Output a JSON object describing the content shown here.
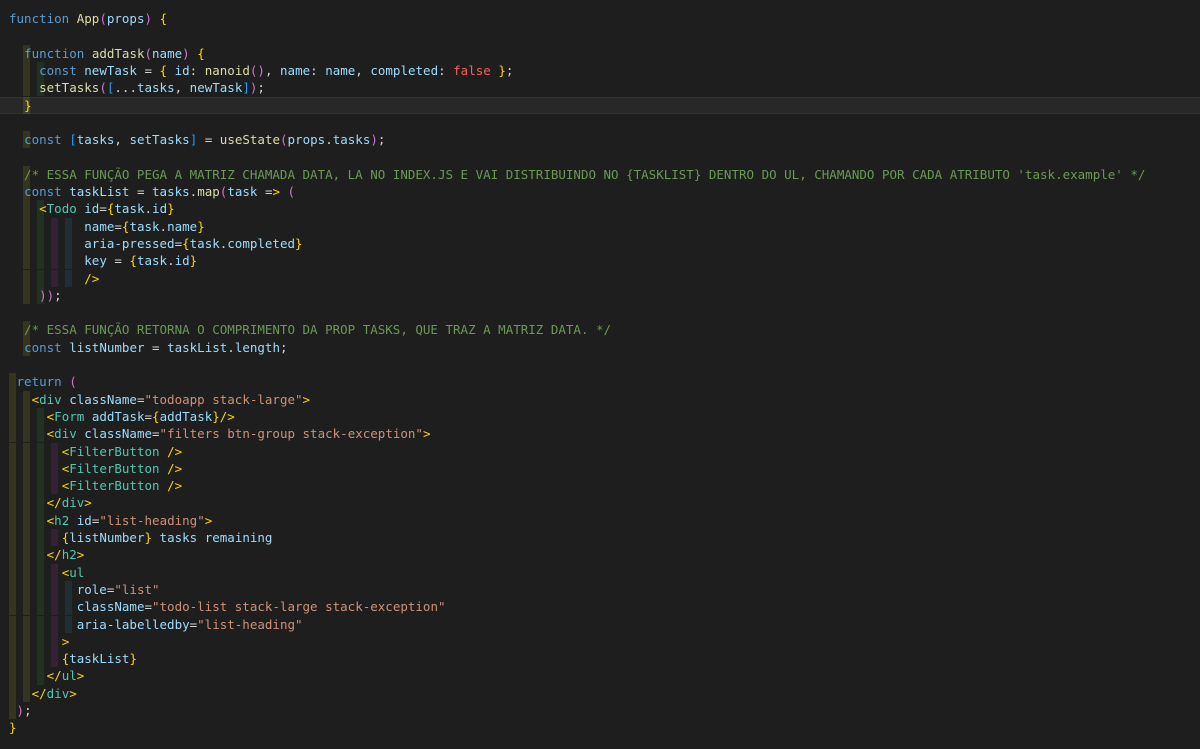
{
  "lines": [
    "function App(props) {",
    "",
    "  function addTask(name) {",
    "    const newTask = { id: nanoid(), name: name, completed: false };",
    "    setTasks([...tasks, newTask]);",
    "  }",
    "",
    "  const [tasks, setTasks] = useState(props.tasks);",
    "",
    "  /* ESSA FUNÇÃO PEGA A MATRIZ CHAMADA DATA, LA NO INDEX.JS E VAI DISTRIBUINDO NO {TASKLIST} DENTRO DO UL, CHAMANDO POR CADA ATRIBUTO 'task.example' */",
    "  const taskList = tasks.map(task => (",
    "    <Todo id={task.id}",
    "          name={task.name}",
    "          aria-pressed={task.completed}",
    "          key = {task.id}",
    "          />",
    "    ));",
    "",
    "  /* ESSA FUNÇÃO RETORNA O COMPRIMENTO DA PROP TASKS, QUE TRAZ A MATRIZ DATA. */",
    "  const listNumber = taskList.length;",
    "",
    " return (",
    "   <div className=\"todoapp stack-large\">",
    "     <Form addTask={addTask}/>",
    "     <div className=\"filters btn-group stack-exception\">",
    "       <FilterButton />",
    "       <FilterButton />",
    "       <FilterButton />",
    "     </div>",
    "     <h2 id=\"list-heading\">",
    "       {listNumber} tasks remaining",
    "     </h2>",
    "       <ul",
    "         role=\"list\"",
    "         className=\"todo-list stack-large stack-exception\"",
    "         aria-labelledby=\"list-heading\"",
    "       >",
    "       {taskList}",
    "     </ul>",
    "   </div>",
    " );",
    "}"
  ],
  "current_line": 5
}
